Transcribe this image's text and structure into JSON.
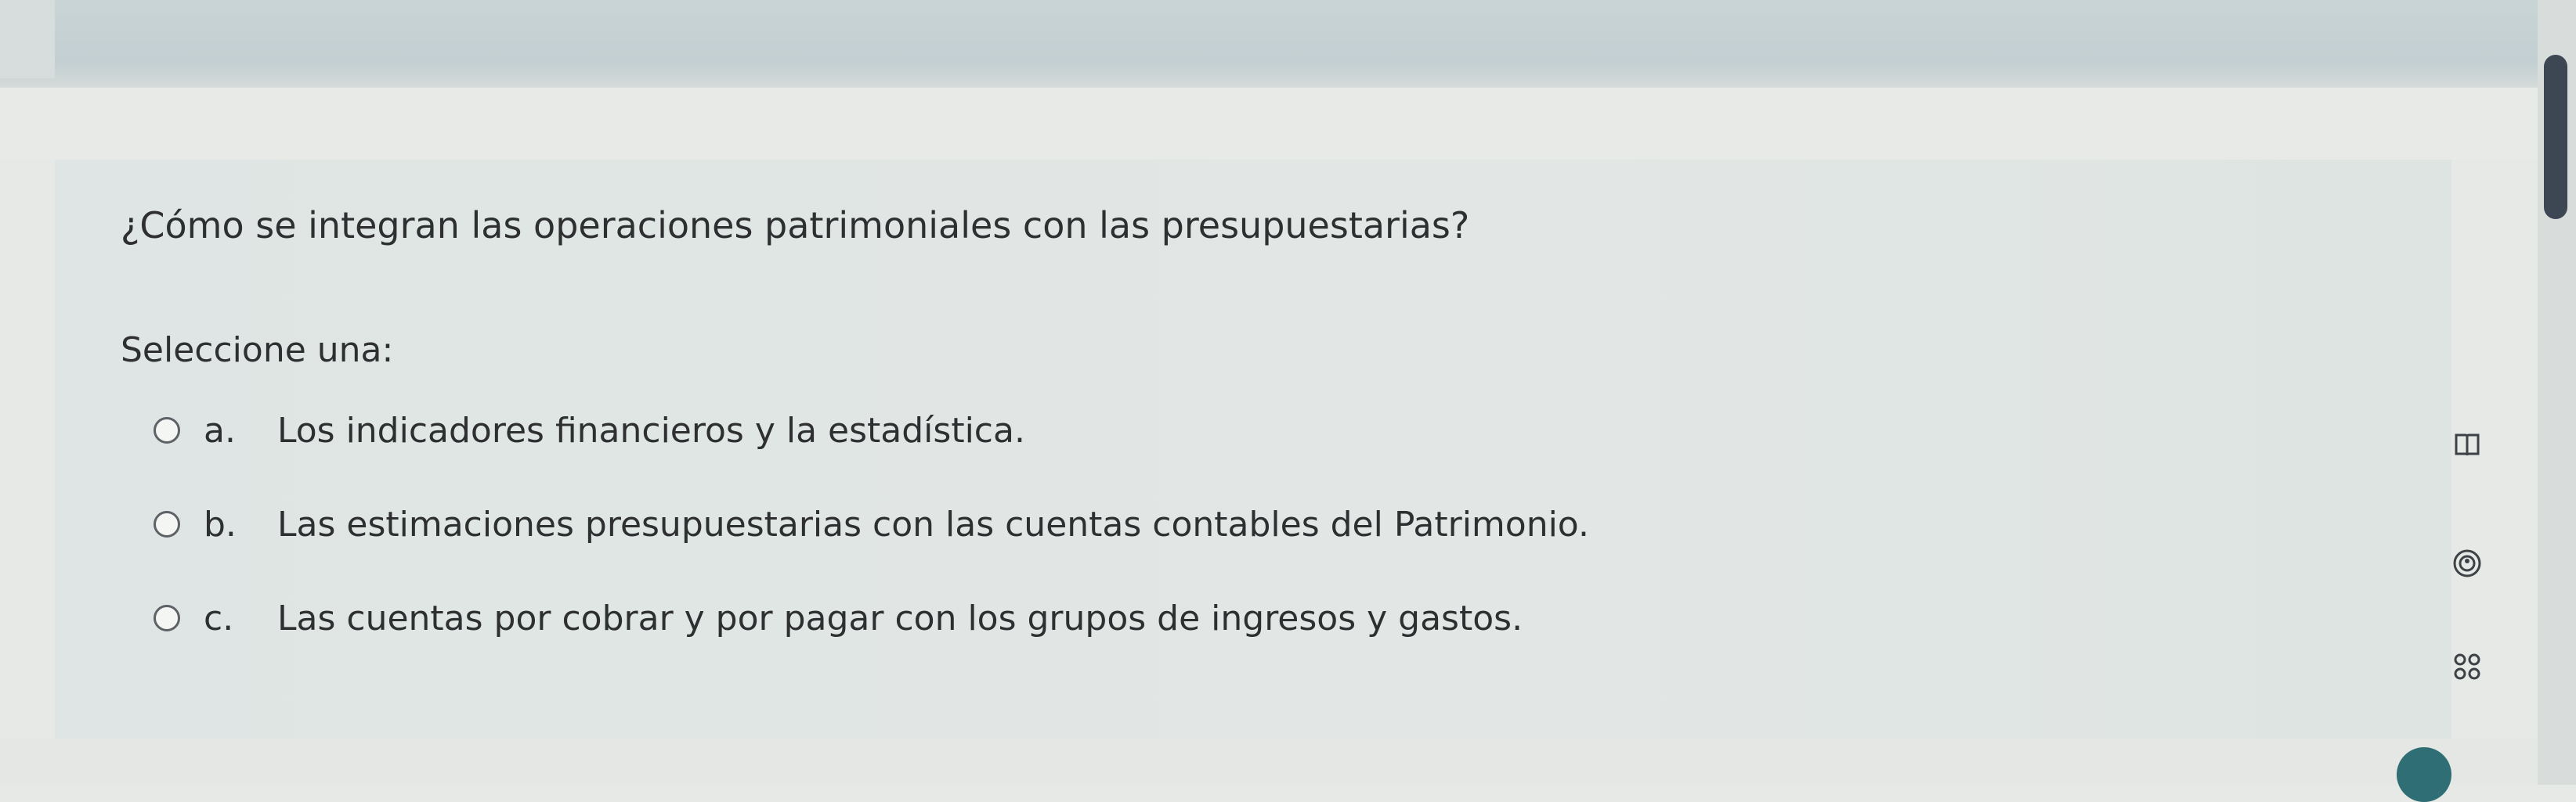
{
  "question": {
    "text": "¿Cómo se integran las operaciones patrimoniales con las presupuestarias?",
    "prompt": "Seleccione una:"
  },
  "options": [
    {
      "letter": "a.",
      "text": "Los indicadores financieros y la estadística."
    },
    {
      "letter": "b.",
      "text": "Las estimaciones presupuestarias con las cuentas contables del Patrimonio."
    },
    {
      "letter": "c.",
      "text": "Las cuentas por cobrar y por pagar con los grupos de ingresos y gastos."
    }
  ],
  "side_icons": [
    "book-icon",
    "accessibility-icon",
    "apps-grid-icon"
  ],
  "colors": {
    "page_background": "#e6e9e5",
    "card_background": "#e0e6e4",
    "text": "#2e2f31",
    "radio_border": "#5e6266",
    "scrollbar_thumb": "#3c4753"
  }
}
